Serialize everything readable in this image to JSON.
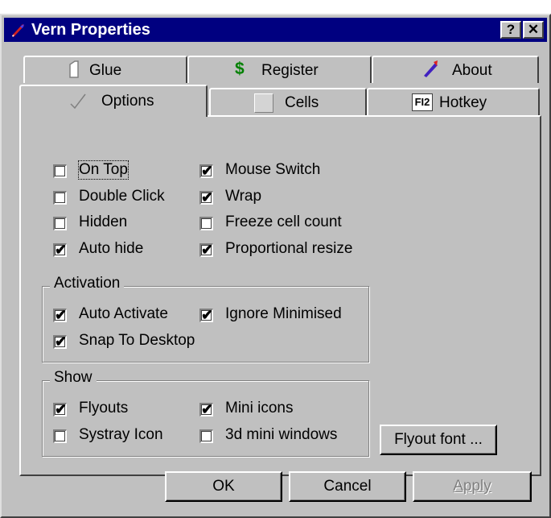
{
  "window": {
    "title": "Vern Properties",
    "help_button": "?",
    "close_button": "✕"
  },
  "tabs": {
    "back_row": [
      {
        "label": "Glue",
        "icon": "document-icon"
      },
      {
        "label": "Register",
        "icon": "dollar-icon",
        "icon_text": "$"
      },
      {
        "label": "About",
        "icon": "quill-icon"
      }
    ],
    "front_row": [
      {
        "label": "Options",
        "icon": "checkmark-icon",
        "selected": true
      },
      {
        "label": "Cells",
        "icon": "cell-icon"
      },
      {
        "label": "Hotkey",
        "icon": "f12-key-icon",
        "icon_text": "FI2"
      }
    ]
  },
  "options": {
    "left": [
      {
        "label": "On Top",
        "checked": false
      },
      {
        "label": "Double Click",
        "checked": false
      },
      {
        "label": "Hidden",
        "checked": false
      },
      {
        "label": "Auto hide",
        "checked": true
      }
    ],
    "right": [
      {
        "label": "Mouse Switch",
        "checked": true
      },
      {
        "label": "Wrap",
        "checked": true
      },
      {
        "label": "Freeze cell count",
        "checked": false
      },
      {
        "label": "Proportional resize",
        "checked": true
      }
    ]
  },
  "activation": {
    "title": "Activation",
    "items": [
      {
        "label": "Auto Activate",
        "checked": true
      },
      {
        "label": "Ignore Minimised",
        "checked": true
      },
      {
        "label": "Snap To Desktop",
        "checked": true
      }
    ]
  },
  "show": {
    "title": "Show",
    "items": [
      {
        "label": "Flyouts",
        "checked": true
      },
      {
        "label": "Mini icons",
        "checked": true
      },
      {
        "label": "Systray Icon",
        "checked": false
      },
      {
        "label": "3d mini windows",
        "checked": false
      }
    ]
  },
  "flyout_font_button": "Flyout font ...",
  "footer": {
    "ok": "OK",
    "cancel": "Cancel",
    "apply": "Apply"
  },
  "tick_glyph": "✔"
}
